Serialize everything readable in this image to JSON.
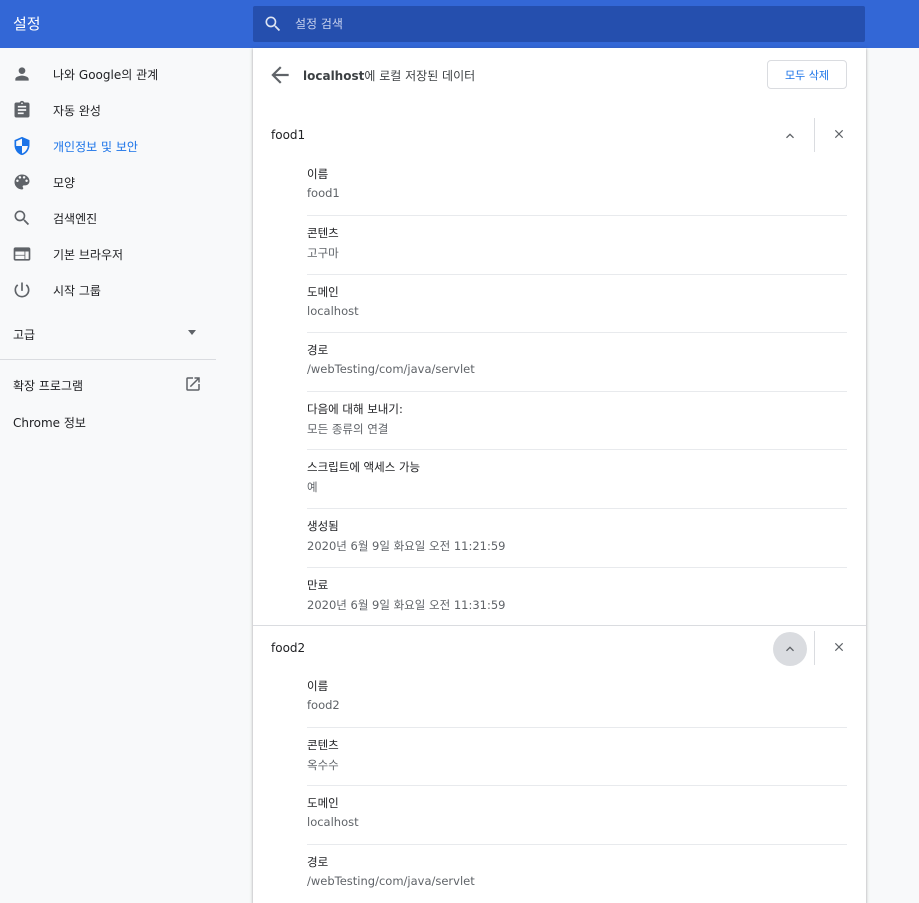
{
  "header": {
    "title": "설정",
    "search_placeholder": "설정 검색"
  },
  "sidebar": {
    "items": [
      {
        "label": "나와 Google의 관계",
        "icon": "person-icon",
        "active": false
      },
      {
        "label": "자동 완성",
        "icon": "clipboard-icon",
        "active": false
      },
      {
        "label": "개인정보 및 보안",
        "icon": "shield-icon",
        "active": true
      },
      {
        "label": "모양",
        "icon": "palette-icon",
        "active": false
      },
      {
        "label": "검색엔진",
        "icon": "search-icon",
        "active": false
      },
      {
        "label": "기본 브라우저",
        "icon": "browser-window-icon",
        "active": false
      },
      {
        "label": "시작 그룹",
        "icon": "power-icon",
        "active": false
      }
    ],
    "advanced_label": "고급",
    "extensions_label": "확장 프로그램",
    "about_label": "Chrome 정보"
  },
  "page": {
    "title_host": "localhost",
    "title_suffix": "에 로컬 저장된 데이터",
    "remove_all_label": "모두 삭제"
  },
  "cookies": [
    {
      "name": "food1",
      "fields": [
        {
          "label": "이름",
          "value": "food1"
        },
        {
          "label": "콘텐츠",
          "value": "고구마"
        },
        {
          "label": "도메인",
          "value": "localhost"
        },
        {
          "label": "경로",
          "value": "/webTesting/com/java/servlet"
        },
        {
          "label": "다음에 대해 보내기:",
          "value": "모든 종류의 연결"
        },
        {
          "label": "스크립트에 액세스 가능",
          "value": "예"
        },
        {
          "label": "생성됨",
          "value": "2020년 6월 9일 화요일 오전 11:21:59"
        },
        {
          "label": "만료",
          "value": "2020년 6월 9일 화요일 오전 11:31:59"
        }
      ]
    },
    {
      "name": "food2",
      "fields": [
        {
          "label": "이름",
          "value": "food2"
        },
        {
          "label": "콘텐츠",
          "value": "옥수수"
        },
        {
          "label": "도메인",
          "value": "localhost"
        },
        {
          "label": "경로",
          "value": "/webTesting/com/java/servlet"
        }
      ]
    }
  ],
  "colors": {
    "header_bg": "#3367d6",
    "search_bg": "#254fae",
    "accent": "#1a73e8"
  }
}
